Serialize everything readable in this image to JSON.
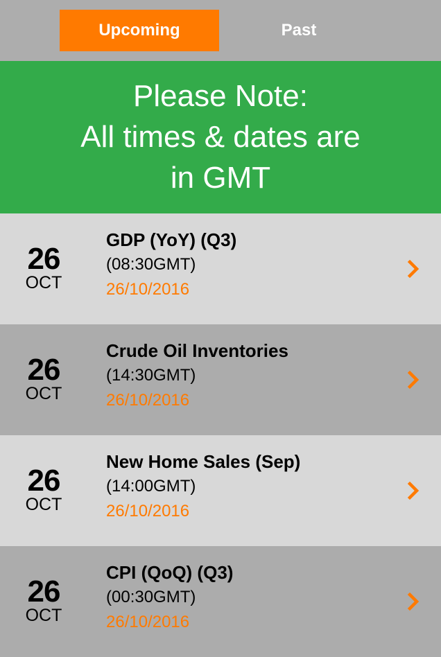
{
  "tabs": {
    "upcoming_label": "Upcoming",
    "past_label": "Past",
    "active": "upcoming"
  },
  "notice": {
    "line1": "Please Note:",
    "line2": "All times & dates are",
    "line3": "in GMT"
  },
  "colors": {
    "accent": "#ff7a00",
    "notice_bg": "#33ab4a",
    "row_light": "#d8d8d8",
    "row_dark": "#acacac"
  },
  "events": [
    {
      "day": "26",
      "month": "OCT",
      "title": "GDP (YoY) (Q3)",
      "time": "(08:30GMT)",
      "date": "26/10/2016",
      "icon": "chevron-right-icon"
    },
    {
      "day": "26",
      "month": "OCT",
      "title": "Crude Oil Inventories",
      "time": "(14:30GMT)",
      "date": "26/10/2016",
      "icon": "chevron-right-icon"
    },
    {
      "day": "26",
      "month": "OCT",
      "title": "New Home Sales (Sep)",
      "time": "(14:00GMT)",
      "date": "26/10/2016",
      "icon": "chevron-right-icon"
    },
    {
      "day": "26",
      "month": "OCT",
      "title": "CPI (QoQ) (Q3)",
      "time": "(00:30GMT)",
      "date": "26/10/2016",
      "icon": "chevron-right-icon"
    }
  ]
}
